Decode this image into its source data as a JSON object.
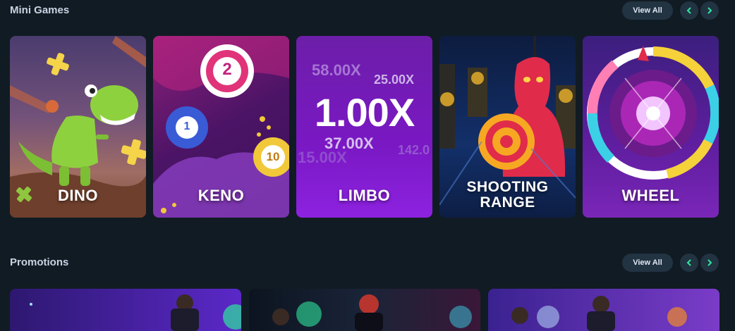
{
  "mini_games": {
    "title": "Mini Games",
    "view_all_label": "View All",
    "prev_icon": "chevron-left-icon",
    "next_icon": "chevron-right-icon",
    "cards": [
      {
        "label": "DINO"
      },
      {
        "label": "KENO"
      },
      {
        "label": "LIMBO",
        "multipliers": [
          "58.00X",
          "25.00X",
          "1.00X",
          "37.00X",
          "15.00X",
          "142.0"
        ]
      },
      {
        "label": "SHOOTING RANGE",
        "label_line1": "SHOOTING",
        "label_line2": "RANGE"
      },
      {
        "label": "WHEEL"
      }
    ],
    "keno_balls": [
      "2",
      "1",
      "10"
    ]
  },
  "promotions": {
    "title": "Promotions",
    "view_all_label": "View All"
  },
  "colors": {
    "background": "#111b23",
    "accent": "#2ee59d",
    "button_bg": "#223342"
  }
}
